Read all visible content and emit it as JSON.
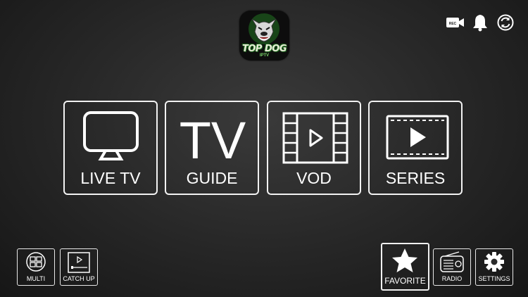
{
  "app": {
    "logo_text": "TOP DOG",
    "logo_sub": "IPTV"
  },
  "top_bar": {
    "icons": [
      "record-icon",
      "bell-icon",
      "refresh-icon"
    ],
    "record_badge": "REC"
  },
  "main_tiles": [
    {
      "label": "LIVE TV",
      "icon": "tv-icon"
    },
    {
      "label": "GUIDE",
      "icon": "tv-letters-icon",
      "icon_text": "TV"
    },
    {
      "label": "VOD",
      "icon": "film-play-icon"
    },
    {
      "label": "SERIES",
      "icon": "series-play-icon"
    }
  ],
  "bottom_left": [
    {
      "label": "MULTI",
      "icon": "multi-screen-icon"
    },
    {
      "label": "CATCH UP",
      "icon": "catch-up-icon"
    }
  ],
  "bottom_right": [
    {
      "label": "FAVORITE",
      "icon": "star-icon",
      "selected": true
    },
    {
      "label": "RADIO",
      "icon": "radio-icon"
    },
    {
      "label": "SETTINGS",
      "icon": "gear-icon"
    }
  ],
  "colors": {
    "foreground": "#ffffff",
    "background": "#2b2b2b",
    "logo_accent": "#2a8a2a"
  }
}
